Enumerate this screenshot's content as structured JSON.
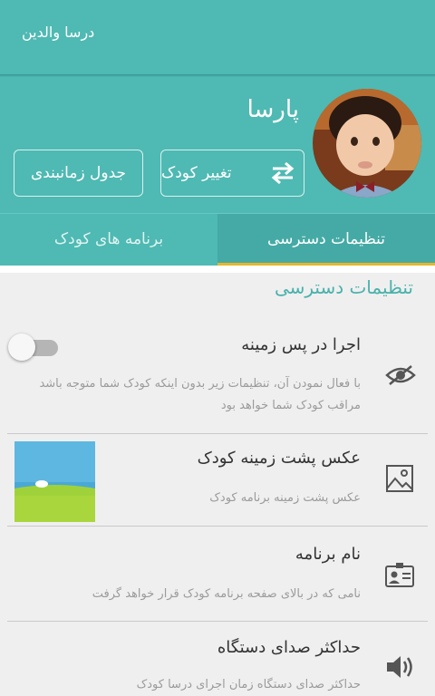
{
  "app": {
    "title": "درسا والدین"
  },
  "profile": {
    "child_name": "پارسا"
  },
  "actions": {
    "change_child": "تغییر کودک",
    "schedule": "جدول زمانبندی"
  },
  "tabs": [
    {
      "label": "تنظیمات دسترسی",
      "active": true
    },
    {
      "label": "برنامه های کودک",
      "active": false
    }
  ],
  "section": {
    "title": "تنظیمات دسترسی"
  },
  "settings": [
    {
      "title": "اجرا در پس زمینه",
      "description": "با فعال نمودن آن، تنظیمات زیر بدون اینکه کودک شما متوجه باشد مراقب کودک شما خواهد بود",
      "icon": "eye-icon",
      "toggle": false
    },
    {
      "title": "عکس پشت زمینه کودک",
      "description": "عکس پشت زمینه برنامه کودک",
      "icon": "image-icon"
    },
    {
      "title": "نام برنامه",
      "description": "نامی که در بالای صفحه برنامه کودک قرار خواهد گرفت",
      "icon": "id-card-icon"
    },
    {
      "title": "حداکثر صدای دستگاه",
      "description": "حداکثر صدای دستگاه زمان اجرای درسا کودک",
      "icon": "volume-icon"
    }
  ],
  "colors": {
    "primary": "#4fb9b3",
    "accent": "#e8b52a",
    "section_title": "#49b1ab"
  }
}
